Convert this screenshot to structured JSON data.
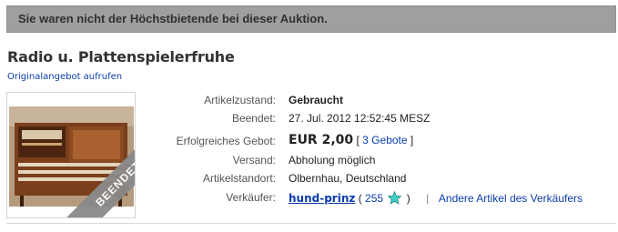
{
  "banner": {
    "message": "Sie waren nicht der Höchstbietende bei dieser Auktion."
  },
  "item": {
    "title": "Radio u. Plattenspielerfruhe",
    "original_link": "Originalangebot aufrufen",
    "ended_ribbon": "BEENDET"
  },
  "details": {
    "condition": {
      "label": "Artikelzustand:",
      "value": "Gebraucht"
    },
    "ended": {
      "label": "Beendet:",
      "value": "27. Jul. 2012 12:52:45 MESZ"
    },
    "winning_bid": {
      "label": "Erfolgreiches Gebot:",
      "value": "EUR 2,00",
      "bids_open": "[",
      "bids_link": "3 Gebote",
      "bids_close": "]"
    },
    "shipping": {
      "label": "Versand:",
      "value": "Abholung möglich"
    },
    "location": {
      "label": "Artikelstandort:",
      "value": "Olbernhau, Deutschland"
    },
    "seller": {
      "label": "Verkäufer:",
      "name": "hund-prinz",
      "feedback_open": "(",
      "feedback_score": "255",
      "feedback_close": ")",
      "separator": "|",
      "other_items_link": "Andere Artikel des Verkäufers",
      "star_icon": "turquoise-star-icon",
      "star_color": "#3fd0c8"
    }
  },
  "colors": {
    "banner_bg": "#9f9f9f",
    "link": "#0b3dab",
    "ribbon": "#8a8a8a"
  }
}
